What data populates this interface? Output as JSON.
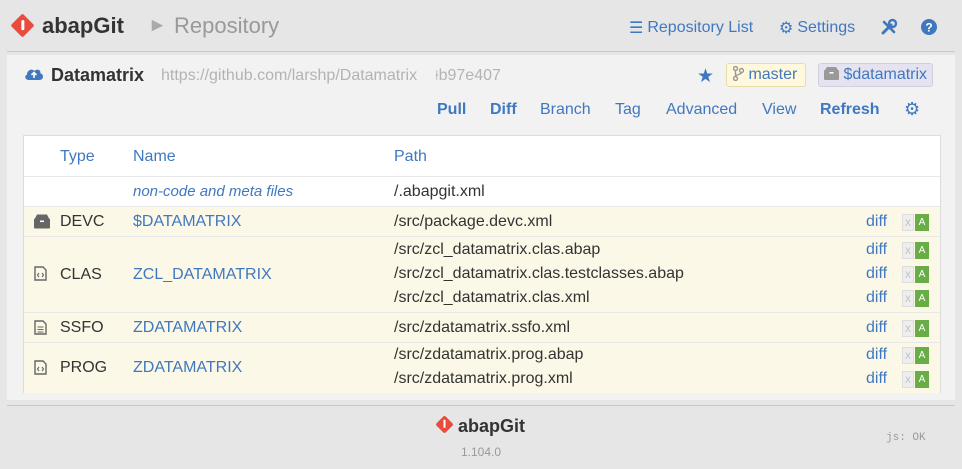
{
  "header": {
    "app_name": "abapGit",
    "breadcrumb_arrow": "►",
    "page_title": "Repository",
    "menu": [
      {
        "label": "Repository List",
        "icon": "list-icon"
      },
      {
        "label": "Settings",
        "icon": "gear-icon"
      },
      {
        "label": "",
        "icon": "tools-icon"
      },
      {
        "label": "",
        "icon": "help-icon"
      }
    ]
  },
  "repo": {
    "name": "Datamatrix",
    "url": "https://github.com/larshp/Datamatrix",
    "commit": "b97e407",
    "branch": "master",
    "package": "$datamatrix",
    "actions": [
      "Pull",
      "Diff",
      "Branch",
      "Tag",
      "Advanced",
      "View",
      "Refresh"
    ]
  },
  "table": {
    "headers": {
      "type": "Type",
      "name": "Name",
      "path": "Path"
    },
    "meta_label": "non-code and meta files",
    "meta_path": "/.abapgit.xml",
    "rows": [
      {
        "type": "DEVC",
        "name": "$DATAMATRIX",
        "icon": "package-icon",
        "files": [
          "/src/package.devc.xml"
        ]
      },
      {
        "type": "CLAS",
        "name": "ZCL_DATAMATRIX",
        "icon": "code-file-icon",
        "files": [
          "/src/zcl_datamatrix.clas.abap",
          "/src/zcl_datamatrix.clas.testclasses.abap",
          "/src/zcl_datamatrix.clas.xml"
        ]
      },
      {
        "type": "SSFO",
        "name": "ZDATAMATRIX",
        "icon": "text-file-icon",
        "files": [
          "/src/zdatamatrix.ssfo.xml"
        ]
      },
      {
        "type": "PROG",
        "name": "ZDATAMATRIX",
        "icon": "code-file-icon",
        "files": [
          "/src/zdatamatrix.prog.abap",
          "/src/zdatamatrix.prog.xml"
        ]
      }
    ],
    "diff_label": "diff",
    "flag_local": "X",
    "flag_remote": "A"
  },
  "footer": {
    "app_name": "abapGit",
    "version": "1.104.0",
    "js_status": "js: OK"
  },
  "colors": {
    "accent": "#4078c0",
    "brand": "#e84c3d",
    "added": "#69ad47"
  }
}
